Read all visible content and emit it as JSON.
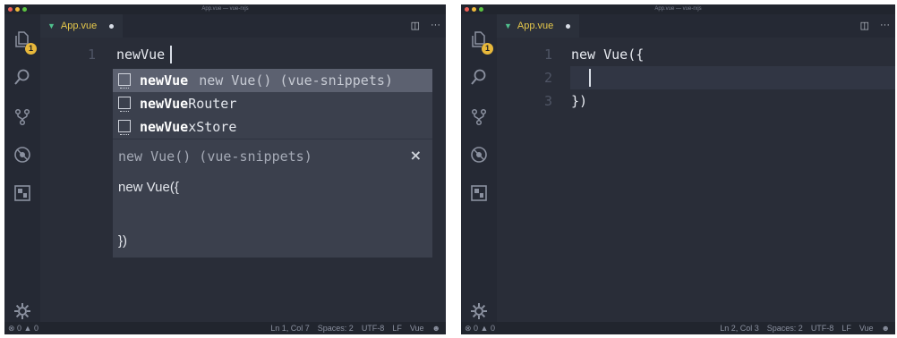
{
  "left": {
    "window_title": "App.vue — vue-rxjs",
    "tab_label": "App.vue",
    "badge_count": "1",
    "lines": [
      {
        "num": "1",
        "text": "newVue"
      }
    ],
    "suggest": {
      "items": [
        {
          "match": "newVue",
          "rest": "",
          "detail": "new Vue() (vue-snippets)"
        },
        {
          "match": "newVue",
          "rest": "Router",
          "detail": ""
        },
        {
          "match": "newVue",
          "rest": "xStore",
          "detail": ""
        }
      ],
      "doc_title": "new Vue() (vue-snippets)",
      "close_glyph": "×",
      "doc_body": "new Vue({\n\n\n})"
    },
    "status": {
      "problems": "⊗ 0 ▲ 0",
      "position": "Ln 1, Col 7",
      "spaces": "Spaces: 2",
      "encoding": "UTF-8",
      "eol": "LF",
      "language": "Vue",
      "smiley": "☻"
    }
  },
  "right": {
    "window_title": "App.vue — vue-rxjs",
    "tab_label": "App.vue",
    "badge_count": "1",
    "lines": [
      {
        "num": "1",
        "text": "new Vue({"
      },
      {
        "num": "2",
        "text": ""
      },
      {
        "num": "3",
        "text": "})"
      }
    ],
    "status": {
      "problems": "⊗ 0 ▲ 0",
      "position": "Ln 2, Col 3",
      "spaces": "Spaces: 2",
      "encoding": "UTF-8",
      "eol": "LF",
      "language": "Vue",
      "smiley": "☻"
    }
  },
  "icons": {
    "tab_type": "vue-logo-icon",
    "split": "split-editor-icon",
    "more": "more-actions-icon",
    "activity": [
      "explorer-icon",
      "search-icon",
      "source-control-icon",
      "debug-icon",
      "extensions-icon",
      "settings-gear-icon"
    ]
  },
  "colors": {
    "accent_vue": "#4fc08d",
    "badge": "#e8b83b",
    "tab_label": "#e6c84b",
    "editor_bg": "#292d38",
    "suggest_selected": "#5c6170"
  }
}
